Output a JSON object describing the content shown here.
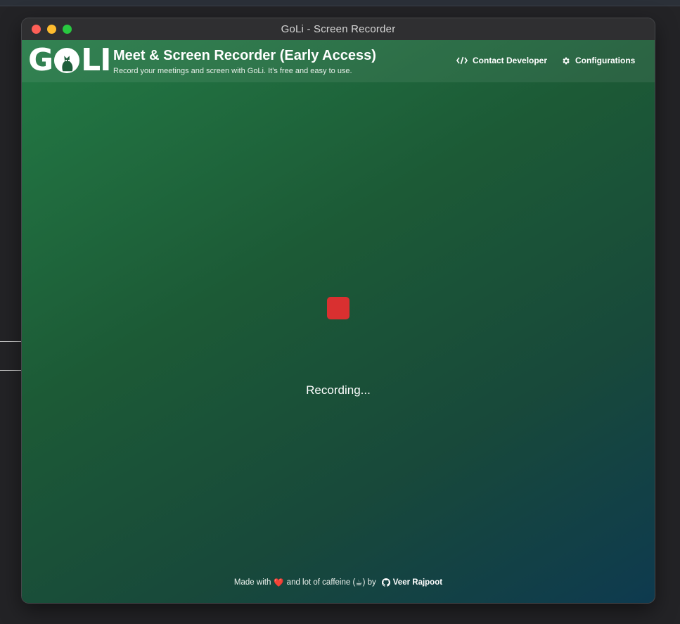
{
  "window": {
    "title": "GoLi - Screen Recorder"
  },
  "header": {
    "logo_left": "G",
    "logo_right": "LI",
    "title": "Meet & Screen Recorder (Early Access)",
    "subtitle": "Record your meetings and screen with GoLi. It's free and easy to use.",
    "nav": {
      "contact_label": "Contact Developer",
      "contact_icon": "code-icon",
      "config_label": "Configurations",
      "config_icon": "gear-icon"
    }
  },
  "main": {
    "record_button_icon": "stop-square-icon",
    "status_text": "Recording..."
  },
  "footer": {
    "made_with": "Made with",
    "heart": "❤️",
    "middle": "and lot of caffeine (",
    "coffee": "☕",
    "end": ") by",
    "author": "Veer Rajpoot",
    "author_icon": "github-icon"
  },
  "colors": {
    "record_button": "#d93030",
    "gradient_start": "#237a45",
    "gradient_end": "#0e3a4f",
    "close": "#fe5f57",
    "minimize": "#febc2e",
    "maximize": "#28c840"
  }
}
